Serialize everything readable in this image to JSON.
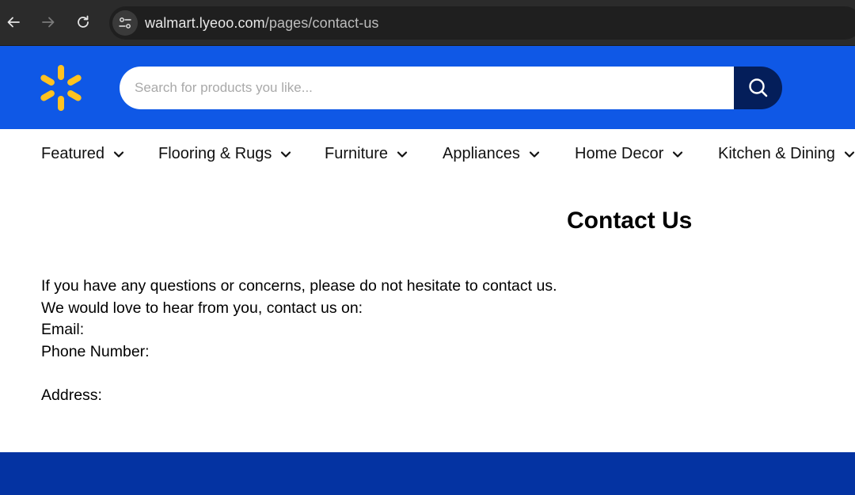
{
  "browser": {
    "url_host": "walmart.lyeoo.com",
    "url_path": "/pages/contact-us"
  },
  "header": {
    "search_placeholder": "Search for products you like...",
    "brand_color": "#0f58e6",
    "spark_color": "#ffc220",
    "search_button_color": "#041e5a"
  },
  "nav": {
    "items": [
      {
        "label": "Featured"
      },
      {
        "label": "Flooring & Rugs"
      },
      {
        "label": "Furniture"
      },
      {
        "label": "Appliances"
      },
      {
        "label": "Home Decor"
      },
      {
        "label": "Kitchen & Dining"
      }
    ]
  },
  "main": {
    "title": "Contact Us",
    "lines": [
      "If you have any questions or concerns, please do not hesitate to contact us.",
      "We would love to hear from you, contact us on:",
      "Email:",
      "Phone Number:",
      "Address:"
    ]
  },
  "footer": {
    "color": "#0433a2"
  }
}
